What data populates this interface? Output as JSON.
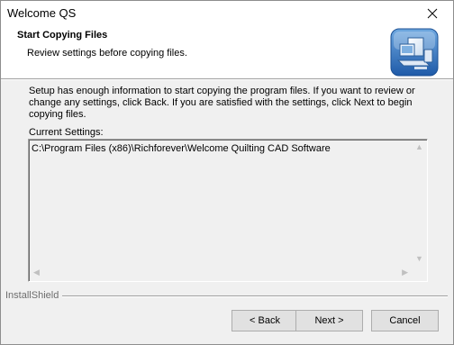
{
  "window": {
    "title": "Welcome QS"
  },
  "header": {
    "title": "Start Copying Files",
    "subtitle": "Review settings before copying files.",
    "icon": "installer-computer-icon"
  },
  "body": {
    "description": "Setup has enough information to start copying the program files.  If you want to review or change any settings, click Back.  If you are satisfied with the settings, click Next to begin copying files.",
    "current_settings_label": "Current Settings:",
    "current_settings_value": "C:\\Program Files (x86)\\Richforever\\Welcome Quilting CAD Software"
  },
  "footer": {
    "brand": "InstallShield",
    "back_label": "< Back",
    "next_label": "Next >",
    "cancel_label": "Cancel"
  }
}
